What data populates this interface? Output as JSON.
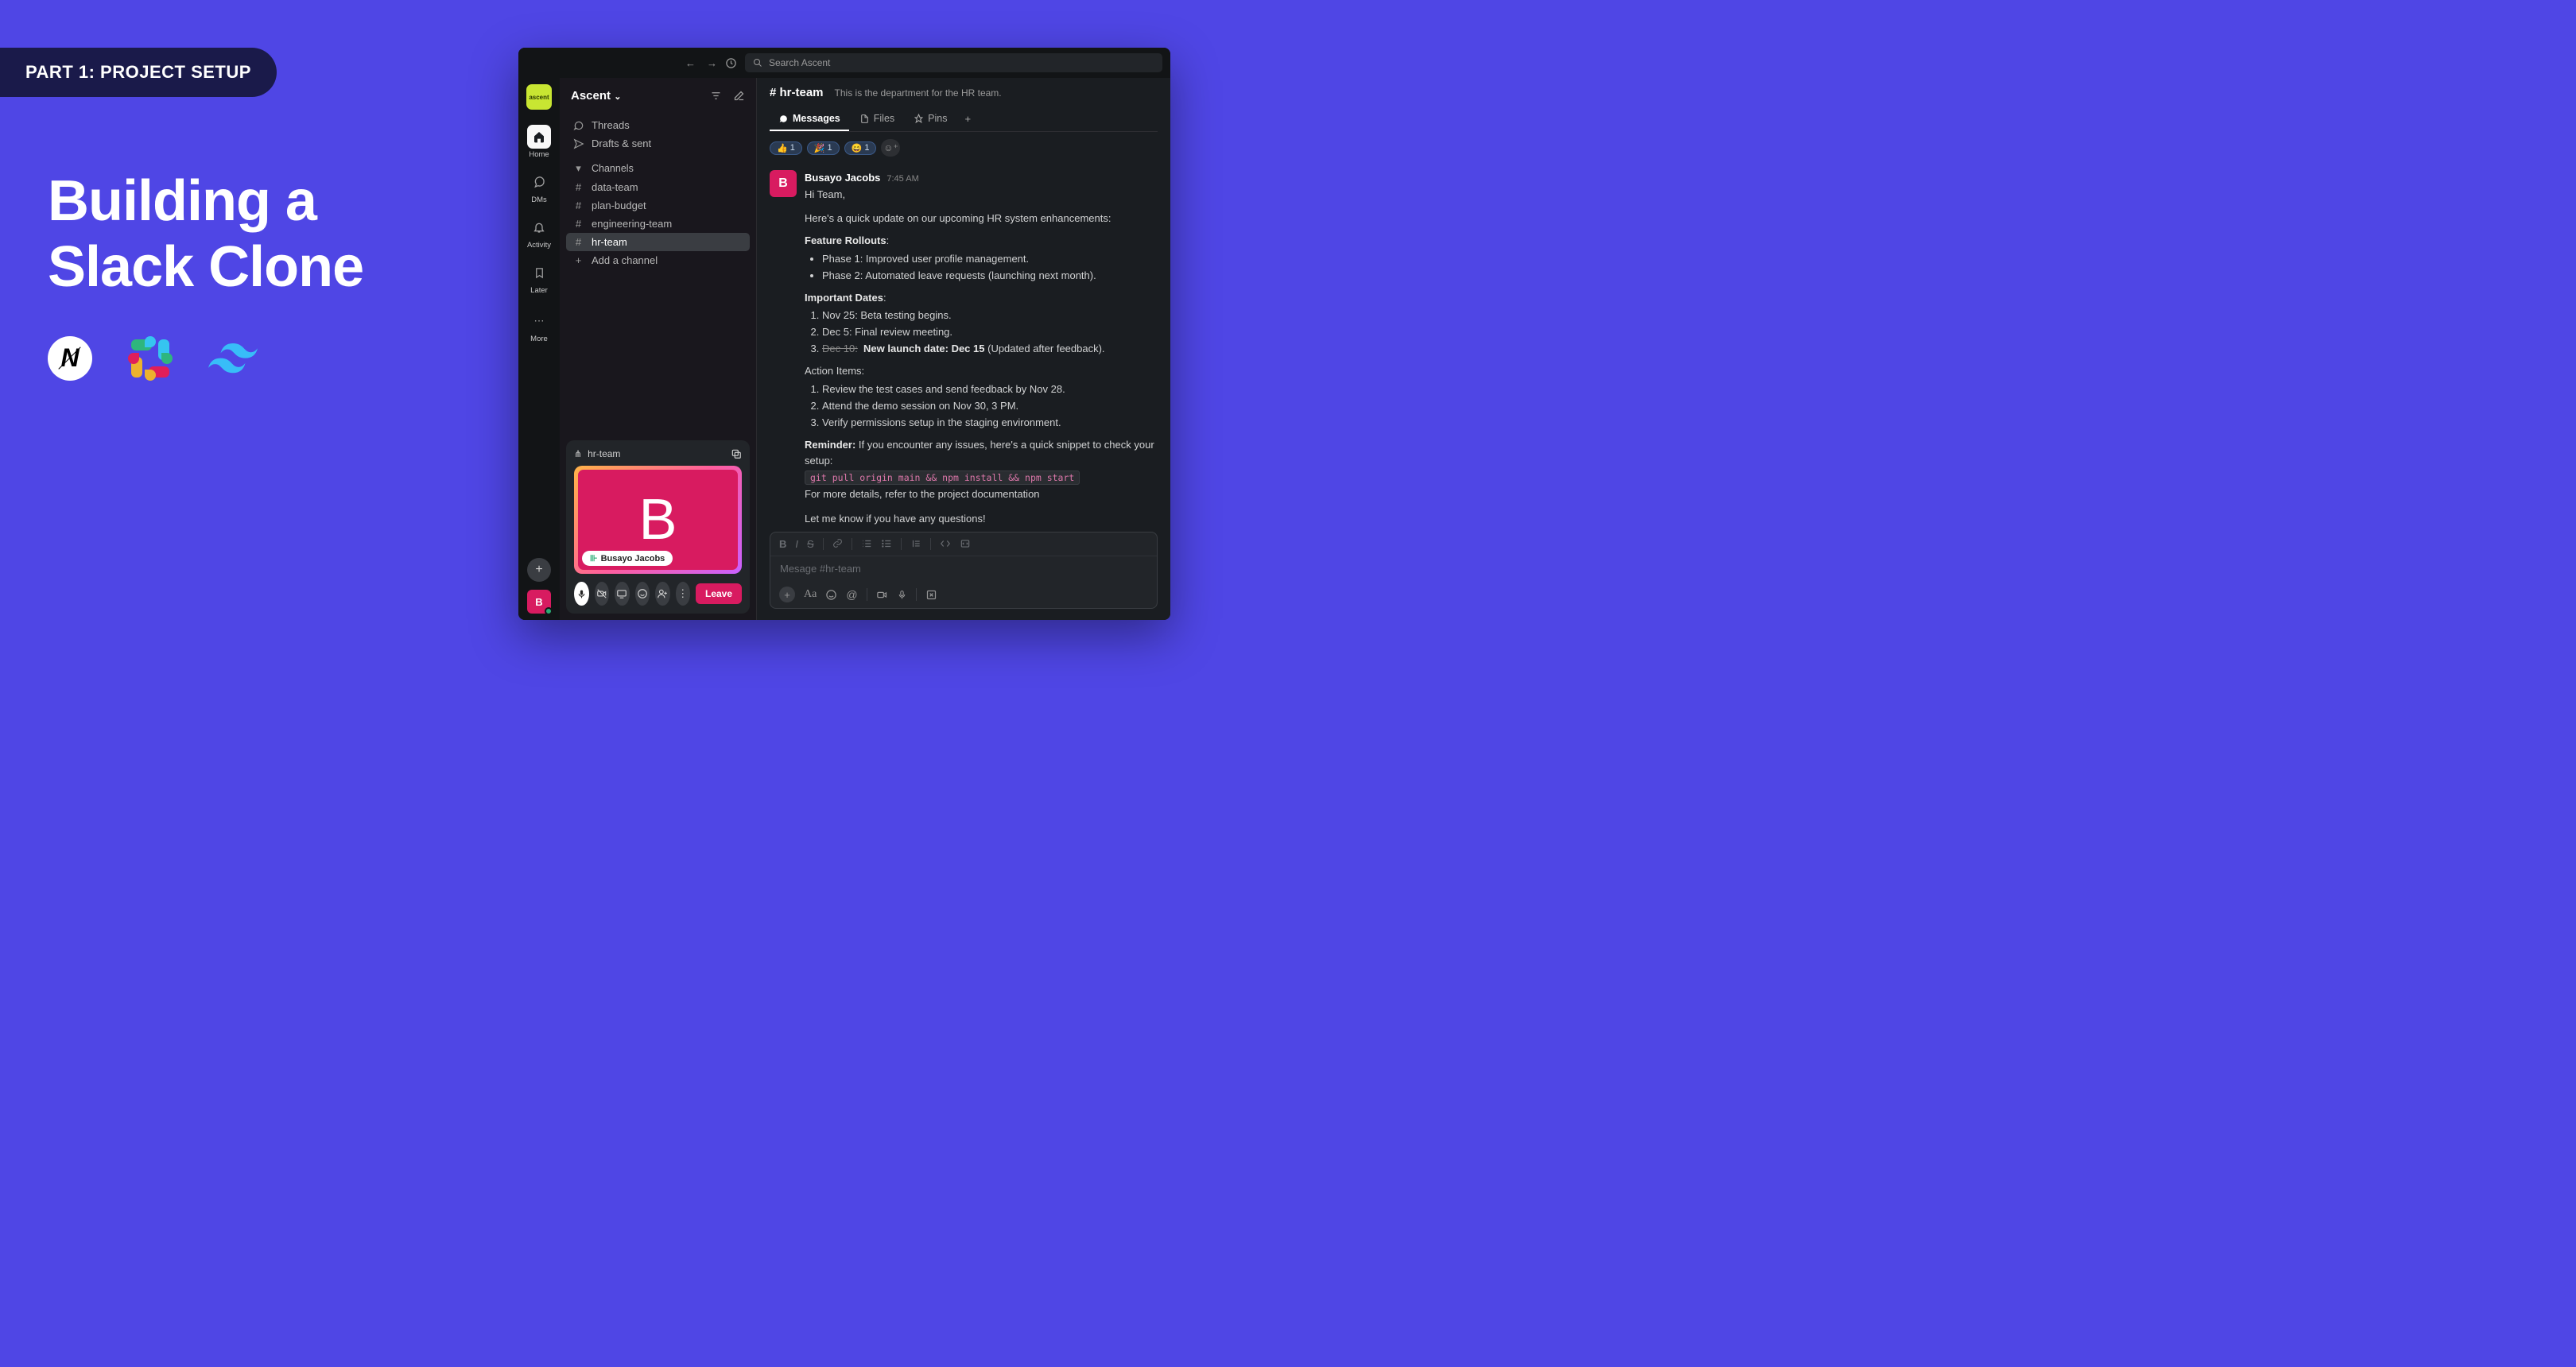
{
  "hero": {
    "part_label": "PART 1: PROJECT SETUP",
    "title_line1": "Building a",
    "title_line2": "Slack Clone",
    "nextjs_letter": "N"
  },
  "topbar": {
    "search_placeholder": "Search Ascent"
  },
  "rail": {
    "workspace_short": "ascent",
    "items": [
      {
        "icon": "home",
        "label": "Home"
      },
      {
        "icon": "dms",
        "label": "DMs"
      },
      {
        "icon": "bell",
        "label": "Activity"
      },
      {
        "icon": "bookmark",
        "label": "Later"
      }
    ],
    "more_label": "More",
    "avatar_letter": "B"
  },
  "sidebar": {
    "workspace": "Ascent",
    "threads": "Threads",
    "drafts": "Drafts & sent",
    "channels_header": "Channels",
    "channels": [
      "data-team",
      "plan-budget",
      "engineering-team",
      "hr-team"
    ],
    "active_channel_index": 3,
    "add_channel": "Add a channel"
  },
  "huddle": {
    "channel": "hr-team",
    "participant": "Busayo Jacobs",
    "big_letter": "B",
    "leave": "Leave"
  },
  "channel": {
    "name": "# hr-team",
    "description": "This is the department for the HR team.",
    "tabs": [
      {
        "icon": "message",
        "label": "Messages"
      },
      {
        "icon": "file",
        "label": "Files"
      },
      {
        "icon": "pin",
        "label": "Pins"
      }
    ],
    "reactions": [
      {
        "emoji": "👍",
        "count": "1"
      },
      {
        "emoji": "🎉",
        "count": "1"
      },
      {
        "emoji": "😄",
        "count": "1"
      }
    ]
  },
  "message": {
    "avatar_letter": "B",
    "author": "Busayo Jacobs",
    "time": "7:45 AM",
    "greeting": "Hi Team,",
    "intro": "Here's a quick update on our upcoming HR system enhancements:",
    "feature_header": "Feature Rollouts",
    "features": [
      "Phase 1: Improved user profile management.",
      "Phase 2: Automated leave requests (launching next month)."
    ],
    "dates_header": "Important Dates",
    "dates": [
      {
        "text": "Nov 25: Beta testing begins."
      },
      {
        "text": "Dec 5: Final review meeting."
      },
      {
        "strike": "Dec 10:",
        "bold": "New launch date: Dec 15",
        "rest": " (Updated after feedback)."
      }
    ],
    "actions_header": "Action Items:",
    "actions": [
      "Review the test cases and send feedback by Nov 28.",
      "Attend the demo session on Nov 30, 3 PM.",
      "Verify permissions setup in the staging environment."
    ],
    "reminder_label": "Reminder:",
    "reminder_text": " If you encounter any issues, here's a quick snippet to check your setup:",
    "code": "git pull origin main && npm install && npm start",
    "more_details": "For more details, refer to the project documentation",
    "closing": "Let me know if you have any questions!"
  },
  "composer": {
    "placeholder": "Mesage #hr-team"
  }
}
